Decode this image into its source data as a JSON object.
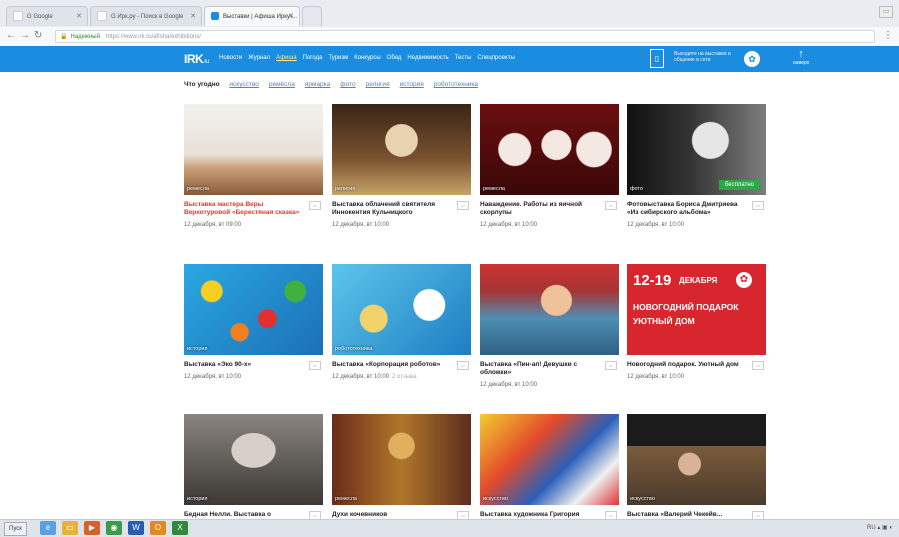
{
  "browser": {
    "tabs": [
      {
        "label": "G Google",
        "active": false,
        "icon": "google-icon"
      },
      {
        "label": "G Ирк.ру - Поиск в Google",
        "active": false,
        "icon": "google-icon"
      },
      {
        "label": "Выставки | Афиша Иркут...",
        "active": true,
        "icon": "irk-icon"
      }
    ],
    "security_label": "Надежный",
    "url": "https://www.irk.ru/afisha/exhibitions/"
  },
  "site": {
    "logo": "IRK",
    "logo_suffix": ".ru",
    "nav": [
      "Новости",
      "Журнал",
      "Афиша",
      "Погода",
      "Туризм",
      "Конкурсы",
      "Обед",
      "Недвижимость",
      "Тесты",
      "Спецпроекты"
    ],
    "nav_current": "Афиша",
    "promo_text": "Выходите на выставки и общение в сети",
    "up_label": "наверх"
  },
  "filters": {
    "title": "Что угодно",
    "items": [
      "искусство",
      "ремёсла",
      "ярмарка",
      "фото",
      "религия",
      "история",
      "робототехника"
    ]
  },
  "cards": [
    {
      "category": "ремесла",
      "title": "Выставка мастера Веры Верхотуровой «Берестяная сказка»",
      "date": "12 декабря, вт 09:00",
      "highlight": true,
      "free": ""
    },
    {
      "category": "религия",
      "title": "Выставка облачений святителя Иннокентия Кульчицкого",
      "date": "12 декабря, вт 10:00",
      "highlight": false,
      "free": ""
    },
    {
      "category": "ремесла",
      "title": "Наваждение. Работы из яичной скорлупы",
      "date": "12 декабря, вт 10:00",
      "highlight": false,
      "free": ""
    },
    {
      "category": "фото",
      "title": "Фотовыставка Бориса Дмитриева «Из сибирского альбома»",
      "date": "12 декабря, вт 10:00",
      "highlight": false,
      "free": "бесплатно"
    },
    {
      "category": "история",
      "title": "Выставка «Эко 90-х»",
      "date": "12 декабря, вт 10:00",
      "highlight": false,
      "free": ""
    },
    {
      "category": "робототехника",
      "title": "Выставка «Корпорация роботов»",
      "date": "12 декабря, вт 10:00",
      "comments": "2 отзыва",
      "highlight": false,
      "free": ""
    },
    {
      "category": "",
      "title": "Выставка «Пин-ап! Девушки с обложки»",
      "date": "12 декабря, вт 10:00",
      "highlight": false,
      "free": ""
    },
    {
      "category": "",
      "title": "Новогодний подарок. Уютный дом",
      "date": "12 декабря, вт 10:00",
      "highlight": false,
      "free": "",
      "poster": {
        "dates": "12-19",
        "month": "ДЕКАБРЯ",
        "line1": "НОВОГОДНИЙ ПОДАРОК",
        "line2": "УЮТНЫЙ ДОМ"
      }
    },
    {
      "category": "история",
      "title": "Бедная Нелли. Выставка о",
      "date": "",
      "highlight": false,
      "free": ""
    },
    {
      "category": "ремесла",
      "title": "Духи кочевников",
      "date": "",
      "highlight": false,
      "free": ""
    },
    {
      "category": "искусство",
      "title": "Выставка художника Григория",
      "date": "",
      "highlight": false,
      "free": ""
    },
    {
      "category": "искусство",
      "title": "Выставка «Валерий Чекейв...",
      "date": "",
      "highlight": false,
      "free": ""
    }
  ],
  "taskbar": {
    "start_label": "Пуск",
    "apps": [
      "explorer-icon",
      "folder-icon",
      "media-icon",
      "chrome-icon",
      "word-icon",
      "outlook-icon",
      "excel-icon"
    ],
    "tray": "RU"
  },
  "colors": {
    "site_blue": "#1a8de0",
    "highlight_red": "#e33333",
    "free_green": "#2ba84a"
  }
}
